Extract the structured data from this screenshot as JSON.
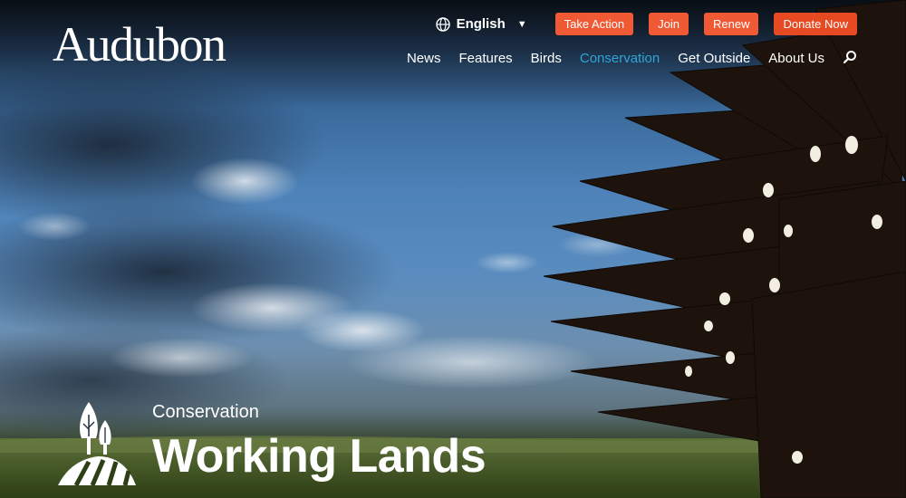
{
  "brand": {
    "logo": "Audubon"
  },
  "utility": {
    "language": "English",
    "buttons": [
      "Take Action",
      "Join",
      "Renew",
      "Donate Now"
    ]
  },
  "nav": {
    "items": [
      "News",
      "Features",
      "Birds",
      "Conservation",
      "Get Outside",
      "About Us"
    ],
    "active": "Conservation"
  },
  "hero": {
    "section_label": "Conservation",
    "title": "Working Lands",
    "section_icon": "trees-on-field-icon"
  },
  "icons": {
    "language": "globe-icon",
    "language_toggle": "caret-down-icon",
    "search": "search-icon"
  },
  "colors": {
    "accent": "#ef5a35",
    "donate": "#e74a22",
    "nav_active": "#2fa4d8"
  }
}
